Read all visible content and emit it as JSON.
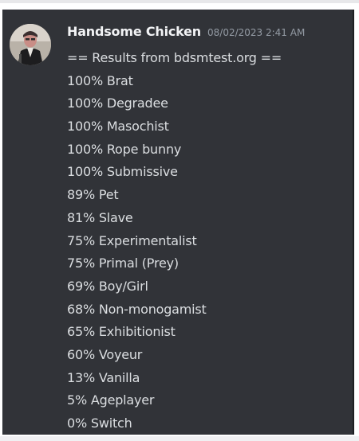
{
  "message": {
    "author": "Handsome Chicken",
    "timestamp": "08/02/2023 2:41 AM",
    "lines": [
      "== Results from bdsmtest.org ==",
      "100% Brat",
      "100% Degradee",
      "100% Masochist",
      "100% Rope bunny",
      "100% Submissive",
      "89% Pet",
      "81% Slave",
      "75% Experimentalist",
      "75% Primal (Prey)",
      "69% Boy/Girl",
      "68% Non-monogamist",
      "65% Exhibitionist",
      "60% Voyeur",
      "13% Vanilla",
      "5% Ageplayer",
      "0% Switch"
    ]
  },
  "avatar": {
    "icon": "user-avatar-photo"
  },
  "colors": {
    "message_background": "#313338",
    "username": "#f2f3f5",
    "timestamp": "#949ba4",
    "text": "#dbdee1"
  }
}
